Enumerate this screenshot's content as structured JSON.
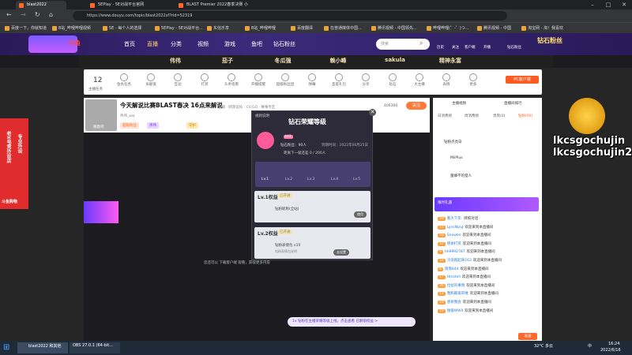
{
  "browser": {
    "tabs": [
      {
        "label": "blast2022",
        "active": true
      },
      {
        "label": "5EPlay - 5E对战平台官网",
        "active": false
      },
      {
        "label": "BLAST Premier 2022春季决赛 小",
        "active": false
      }
    ],
    "url": "https://www.douyu.com/topic/blast2022sf?rid=52319",
    "bookmarks": [
      "百度一下，你就知道",
      "B站_哔哩哔哩视频",
      "5E - 每个人的选择",
      "5EPlay - 5E对战平台...",
      "东信乐享",
      "B站_哔哩哔哩",
      "百度翻译",
      "在普通媒体中国...",
      "腾讯视频 - 中国领先...",
      "哔哩哔哩(゜-゜)つ...",
      "腾讯视频 - 中国",
      "淘宝网 - 淘！我喜欢"
    ]
  },
  "site": {
    "logo_text": "斗鱼",
    "nav": [
      "首页",
      "直播",
      "分类",
      "视频",
      "游戏",
      "鱼吧",
      "钻石粉丝"
    ],
    "search_placeholder": "搜索",
    "top_right": [
      "历史",
      "关注",
      "客户端",
      "开播",
      "钻石粉丝"
    ],
    "corner_badge": "钻石粉丝"
  },
  "streamers": [
    "伟伟",
    "茄子",
    "冬瓜强",
    "赖小峰",
    "sakula",
    "精神永富"
  ],
  "giftbar": {
    "count": "12",
    "count_label": "主播任务",
    "items": [
      "鱼丸任务",
      "贡献值",
      "互动",
      "打赏",
      "头条指南",
      "开播提醒",
      "超级粉丝团",
      "弹幕",
      "圣诞礼包",
      "分享",
      "钻石",
      "大主播",
      "表情",
      "更多"
    ],
    "pc_button": "PC客户端"
  },
  "room": {
    "title": "今天解说比赛BLAST春决 16点来解说",
    "meta": "直播 · 网游竞技 · CS:GO · 赛事专区",
    "tags": [
      "超级粉丝",
      "伟伟",
      "守护"
    ],
    "follow_count": "406300",
    "follow_label": "关注",
    "streamer_id": "伟伟_ww",
    "level_tag": "Lv.1",
    "watermark": "随意吧"
  },
  "modal": {
    "header": "钻石荣耀等级",
    "sub_left": "规则说明",
    "level_label": "LV1",
    "fans_value": "钻石粉丝：90人",
    "expire": "到期时间：2022年06月25日",
    "progress_text": "距离下一级还差 0 / 200人",
    "levels": [
      "Lv.1",
      "Lv.2",
      "Lv.3",
      "Lv.4",
      "Lv.5"
    ],
    "card1_title": "Lv.1权益",
    "card1_badge": "已开通",
    "card1_item": "钻粉昵称(全站)",
    "card1_btn": "使用",
    "card2_title": "Lv.2权益",
    "card2_badge": "已开通",
    "card2_item": "钻粉表情包 x10",
    "card2_sub": "钻粉表情包说明",
    "card2_btn": "去设置"
  },
  "player_notice": "您还可以 下载客户端 观看，获取更多内容",
  "rightpanel": {
    "tabs": [
      "主播视频",
      "直播间排行"
    ],
    "subtabs": [
      "日消费榜",
      "周消费榜",
      "贵宾(0)",
      "钻粉(90)"
    ],
    "rank_title": "钻粉点亮日",
    "ranks": [
      {
        "name": "MiiPlus"
      },
      {
        "name": "蜜蜂不的猎人"
      }
    ],
    "banner_text": "限时礼遇",
    "messages": [
      {
        "lv": "18",
        "name": "看大下年:",
        "text": "牌照对话"
      },
      {
        "lv": "11",
        "name": "LynsNorg",
        "text": "欢迎来到本直播间"
      },
      {
        "lv": "16",
        "name": "Snowbe",
        "text": "欢迎来到本直播间"
      },
      {
        "lv": "22",
        "name": "感谢打赏",
        "text": "欢迎来到本直播间"
      },
      {
        "lv": "9",
        "name": "hh9992787",
        "text": "欢迎来到本直播间"
      },
      {
        "lv": "14",
        "name": "冷浪跑起来163",
        "text": "欢迎来到本直播间"
      },
      {
        "lv": "8",
        "name": "雨落844",
        "text": "欢迎来到本直播间"
      },
      {
        "lv": "17",
        "name": "Hmstell",
        "text": "欢迎来到本直播间"
      },
      {
        "lv": "26",
        "name": "拉扯的事情",
        "text": "欢迎来到本直播间"
      },
      {
        "lv": "12",
        "name": "我和最爱的唯",
        "text": "欢迎来到本直播间"
      },
      {
        "lv": "10",
        "name": "感谢我会",
        "text": "欢迎来到本直播间"
      },
      {
        "lv": "19",
        "name": "独狼WWII",
        "text": "欢迎来到本直播间"
      }
    ],
    "bottom_buttons": [
      "发送"
    ]
  },
  "overlay": {
    "name_line1": "lkcsgochujin",
    "name_line2": "lkcsgochujin2",
    "left_banner": "斗鱼购物",
    "left_vtext1": "老X电竞外设店",
    "left_vtext2": "专业外设"
  },
  "bottom_notice": "1x 钻粉在主播荣耀等级上线，点击查看 已解锁权益 >",
  "taskbar": {
    "items": [
      "blast2022 和其他",
      "OBS 27.0.1 (64-bit..."
    ],
    "weather": "32°C 多云",
    "time": "16:24",
    "date": "2022/6/16",
    "lang": "中"
  },
  "colors": {
    "accent": "#ff6a2c",
    "header": "#2a1a5a",
    "modal": "#2d2b3a"
  }
}
